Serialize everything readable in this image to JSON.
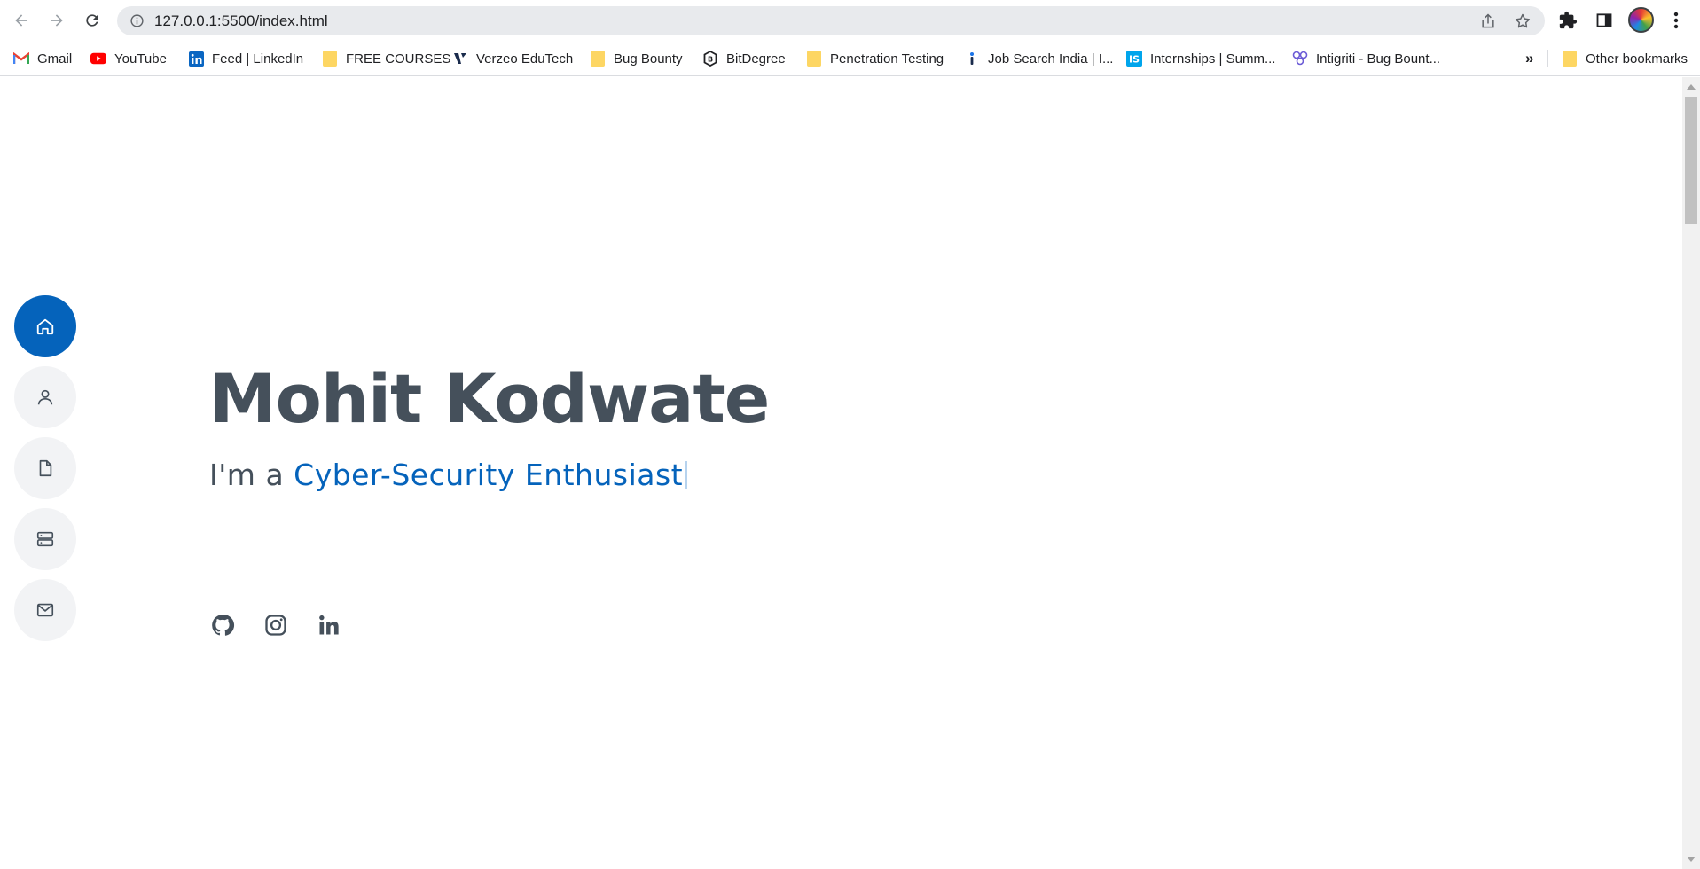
{
  "browser": {
    "url": "127.0.0.1:5500/index.html",
    "bookmarks": [
      {
        "label": "Gmail",
        "icon": "gmail-icon"
      },
      {
        "label": "YouTube",
        "icon": "youtube-icon"
      },
      {
        "label": "Feed | LinkedIn",
        "icon": "linkedin-icon"
      },
      {
        "label": "FREE COURSES",
        "icon": "folder-icon"
      },
      {
        "label": "Verzeo EduTech",
        "icon": "verzeo-icon"
      },
      {
        "label": "Bug Bounty",
        "icon": "folder-icon"
      },
      {
        "label": "BitDegree",
        "icon": "bitdegree-icon"
      },
      {
        "label": "Penetration Testing",
        "icon": "folder-icon"
      },
      {
        "label": "Job Search India | I...",
        "icon": "info-icon"
      },
      {
        "label": "Internships | Summ...",
        "icon": "internshala-icon"
      },
      {
        "label": "Intigriti - Bug Bount...",
        "icon": "intigriti-icon"
      }
    ],
    "more_bookmarks": "»",
    "other_bookmarks": "Other bookmarks"
  },
  "side_nav": [
    {
      "name": "home",
      "icon": "home-icon",
      "active": true
    },
    {
      "name": "about",
      "icon": "user-icon",
      "active": false
    },
    {
      "name": "resume",
      "icon": "file-icon",
      "active": false
    },
    {
      "name": "services",
      "icon": "server-icon",
      "active": false
    },
    {
      "name": "contact",
      "icon": "envelope-icon",
      "active": false
    }
  ],
  "hero": {
    "name": "Mohit Kodwate",
    "subtitle_prefix": "I'm a ",
    "subtitle_typed": "Cyber-Security Enthusiast"
  },
  "socials": [
    {
      "name": "github",
      "icon": "github-icon"
    },
    {
      "name": "instagram",
      "icon": "instagram-icon"
    },
    {
      "name": "linkedin",
      "icon": "linkedin-icon"
    }
  ],
  "colors": {
    "accent": "#0563bb",
    "heading": "#45505b",
    "nav_bg": "#f2f3f5"
  }
}
